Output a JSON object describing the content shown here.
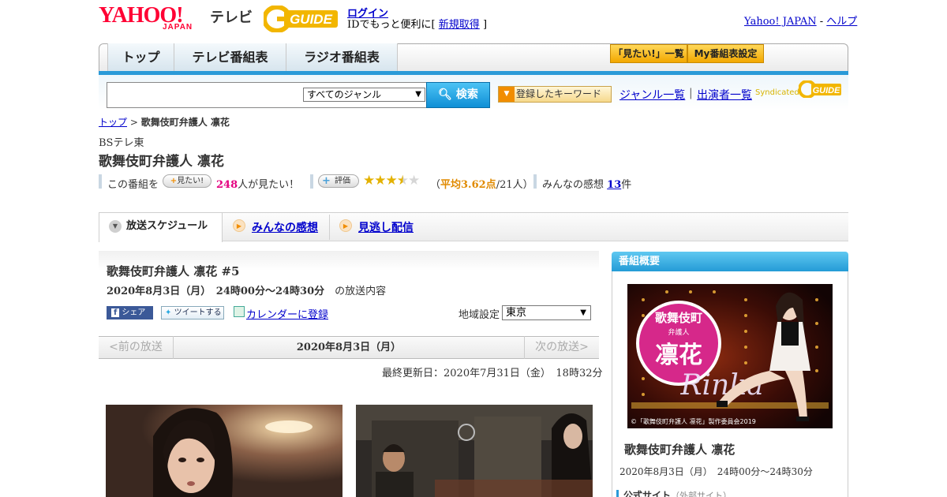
{
  "header": {
    "logo_yahoo": "YAHOO!",
    "logo_japan": "JAPAN",
    "logo_tv": "テレビ",
    "logo_gguide": "G GUIDE",
    "login": "ログイン",
    "id_prefix": "IDでもっと便利に[",
    "register": "新規取得",
    "id_suffix": "]",
    "yahoo_japan": "Yahoo! JAPAN",
    "dash": " - ",
    "help": "ヘルプ"
  },
  "nav": {
    "tabs": [
      {
        "label": "トップ"
      },
      {
        "label": "テレビ番組表"
      },
      {
        "label": "ラジオ番組表"
      }
    ],
    "mitai_list": "「見たい!」一覧",
    "my_bangumi": "My番組表設定"
  },
  "search": {
    "placeholder": "",
    "genre_selected": "すべてのジャンル",
    "search_button": "検索",
    "keyword_button": "登録したキーワード",
    "genre_list": "ジャンル一覧",
    "separator": "|",
    "cast_list": "出演者一覧",
    "syndicated": "Syndicated"
  },
  "breadcrumb": {
    "top": "トップ",
    "sep": " > ",
    "current": "歌舞伎町弁護人 凛花"
  },
  "program": {
    "station": "BSテレ東",
    "title": "歌舞伎町弁護人 凛花",
    "mitai_prefix": "この番組を",
    "mitai_button": "見たい!",
    "mitai_count": "248",
    "mitai_suffix": "人が見たい！",
    "rating_button": "評価",
    "rating_value": 3.62,
    "rating_open": "（",
    "rating_avg": "平均3.62点",
    "rating_count": "/21人）",
    "impressions_prefix": "みんなの感想",
    "impressions_count": "13",
    "impressions_suffix": "件"
  },
  "tabs": {
    "schedule": "放送スケジュール",
    "impressions": "みんなの感想",
    "streaming": "見逃し配信"
  },
  "episode": {
    "title": "歌舞伎町弁護人 凛花 #5",
    "date": "2020年8月3日（月）　24時00分～24時30分",
    "date_suffix": "の放送内容",
    "share_fb": "シェア",
    "share_tw": "ツイートする",
    "calendar": "カレンダーに登録",
    "region_label": "地域設定",
    "region_selected": "東京",
    "prev": "<前の放送",
    "current_date": "2020年8月3日（月）",
    "next": "次の放送>",
    "updated": "最終更新日：2020年7月31日（金）　18時32分"
  },
  "sidebar": {
    "heading": "番組概要",
    "poster_caption": "©「歌舞伎町弁護人 凛花」製作委員会2019",
    "poster_title_top": "歌舞伎町",
    "poster_title_sub": "弁護人",
    "poster_title_main": "凛花",
    "poster_script": "Rinka",
    "title": "歌舞伎町弁護人 凛花",
    "date": "2020年8月3日（月）　24時00分～24時30分",
    "official": "公式サイト",
    "official_ext": "（外部サイト）"
  },
  "colors": {
    "accent_blue": "#2a9ad8",
    "yahoo_red": "#ff0033",
    "star": "#e3b100",
    "pink": "#e4007f"
  }
}
